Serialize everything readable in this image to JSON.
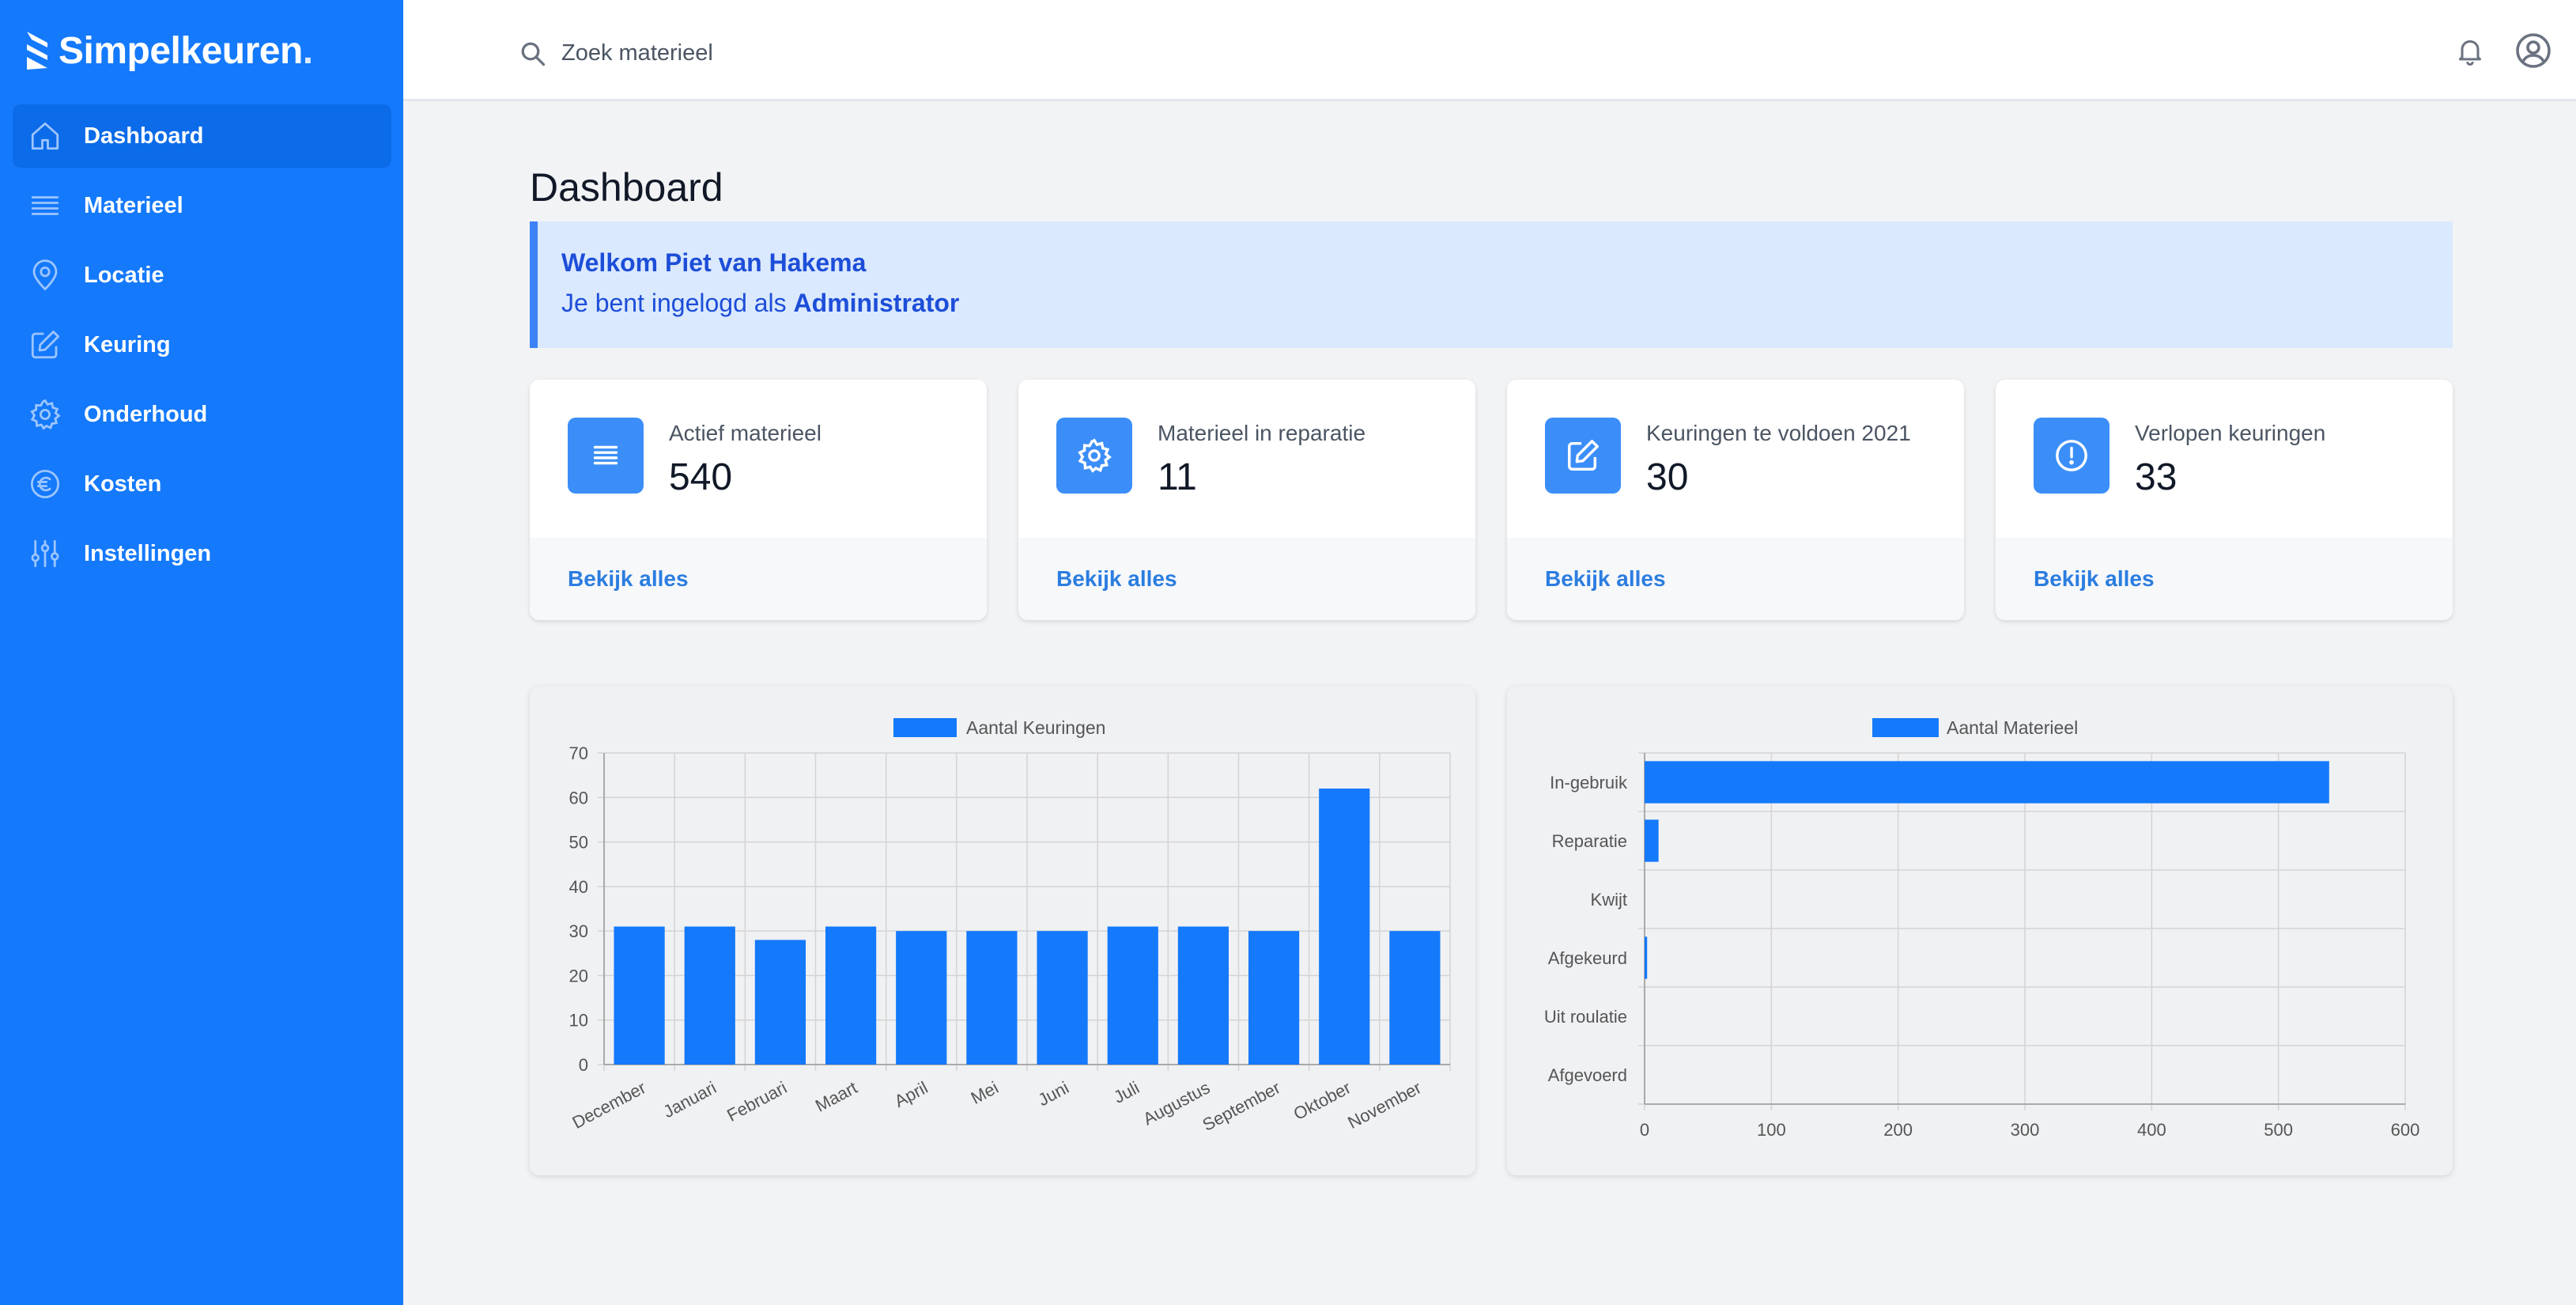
{
  "brand": {
    "name": "Simpelkeuren",
    "dot": "."
  },
  "sidebar": {
    "items": [
      {
        "label": "Dashboard",
        "icon": "home-icon",
        "active": true
      },
      {
        "label": "Materieel",
        "icon": "list-icon",
        "active": false
      },
      {
        "label": "Locatie",
        "icon": "map-pin-icon",
        "active": false
      },
      {
        "label": "Keuring",
        "icon": "edit-icon",
        "active": false
      },
      {
        "label": "Onderhoud",
        "icon": "gear-icon",
        "active": false
      },
      {
        "label": "Kosten",
        "icon": "euro-icon",
        "active": false
      },
      {
        "label": "Instellingen",
        "icon": "sliders-icon",
        "active": false
      }
    ]
  },
  "topbar": {
    "search_placeholder": "Zoek materieel"
  },
  "main": {
    "title": "Dashboard",
    "welcome": {
      "title": "Welkom Piet van Hakema",
      "sub_prefix": "Je bent ingelogd als",
      "role": "Administrator"
    },
    "stats": [
      {
        "label": "Actief materieel",
        "value": "540",
        "link": "Bekijk alles",
        "icon": "list-icon"
      },
      {
        "label": "Materieel in reparatie",
        "value": "11",
        "link": "Bekijk alles",
        "icon": "gear-icon"
      },
      {
        "label": "Keuringen te voldoen 2021",
        "value": "30",
        "link": "Bekijk alles",
        "icon": "edit-icon"
      },
      {
        "label": "Verlopen keuringen",
        "value": "33",
        "link": "Bekijk alles",
        "icon": "alert-icon"
      }
    ]
  },
  "colors": {
    "accent": "#1479fb",
    "bar": "#1479fb"
  },
  "chart_data": [
    {
      "type": "bar",
      "orientation": "vertical",
      "categories": [
        "December",
        "Januari",
        "Februari",
        "Maart",
        "April",
        "Mei",
        "Juni",
        "Juli",
        "Augustus",
        "September",
        "Oktober",
        "November"
      ],
      "series": [
        {
          "name": "Aantal Keuringen",
          "values": [
            31,
            31,
            28,
            31,
            30,
            30,
            30,
            31,
            31,
            30,
            62,
            30
          ]
        }
      ],
      "yticks": [
        "0",
        "10",
        "20",
        "30",
        "40",
        "50",
        "60",
        "70"
      ],
      "ylim": [
        0,
        70
      ],
      "grid": true,
      "legend": "top"
    },
    {
      "type": "bar",
      "orientation": "horizontal",
      "categories": [
        "In-gebruik",
        "Reparatie",
        "Kwijt",
        "Afgekeurd",
        "Uit roulatie",
        "Afgevoerd"
      ],
      "series": [
        {
          "name": "Aantal Materieel",
          "values": [
            540,
            11,
            0,
            2,
            0,
            0
          ]
        }
      ],
      "xticks": [
        "0",
        "100",
        "200",
        "300",
        "400",
        "500",
        "600"
      ],
      "xlim": [
        0,
        600
      ],
      "grid": true,
      "legend": "top"
    }
  ]
}
